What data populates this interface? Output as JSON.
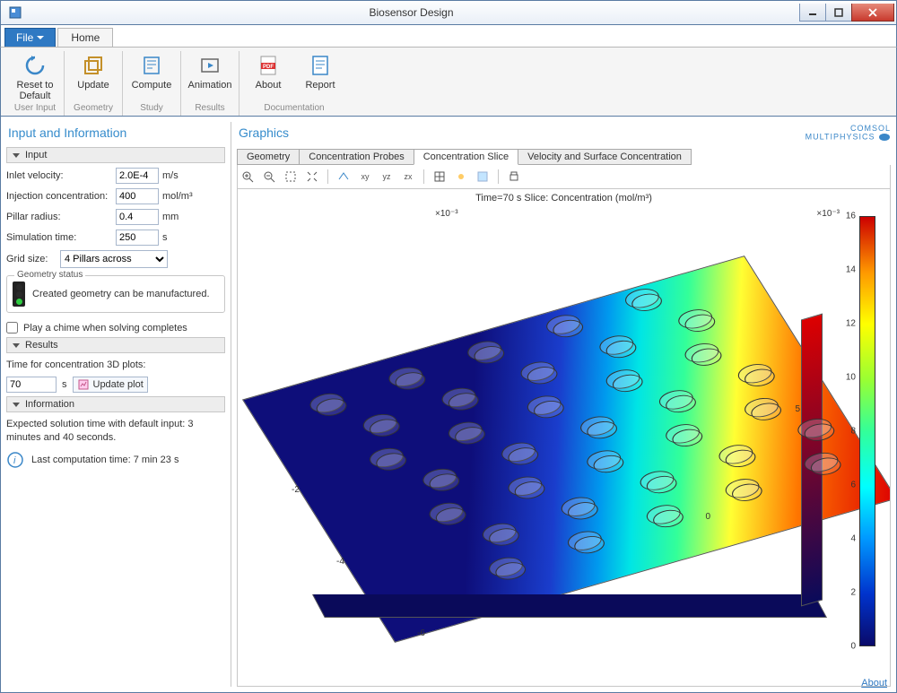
{
  "window": {
    "title": "Biosensor Design"
  },
  "ribbon": {
    "file_label": "File",
    "tabs": {
      "home": "Home"
    },
    "groups": [
      {
        "label": "User Input",
        "items": [
          {
            "name": "reset-to-default",
            "label": "Reset to\nDefault"
          }
        ]
      },
      {
        "label": "Geometry",
        "items": [
          {
            "name": "update-geometry",
            "label": "Update"
          }
        ]
      },
      {
        "label": "Study",
        "items": [
          {
            "name": "compute",
            "label": "Compute"
          }
        ]
      },
      {
        "label": "Results",
        "items": [
          {
            "name": "animation",
            "label": "Animation"
          }
        ]
      },
      {
        "label": "Documentation",
        "items": [
          {
            "name": "about",
            "label": "About"
          },
          {
            "name": "report",
            "label": "Report"
          }
        ]
      }
    ]
  },
  "left": {
    "title": "Input and Information",
    "sections": {
      "input": "Input",
      "results": "Results",
      "info": "Information"
    },
    "fields": {
      "inlet_velocity": {
        "label": "Inlet velocity:",
        "value": "2.0E-4",
        "unit": "m/s"
      },
      "injection_conc": {
        "label": "Injection concentration:",
        "value": "400",
        "unit": "mol/m³"
      },
      "pillar_radius": {
        "label": "Pillar radius:",
        "value": "0.4",
        "unit": "mm"
      },
      "sim_time": {
        "label": "Simulation time:",
        "value": "250",
        "unit": "s"
      },
      "grid_size": {
        "label": "Grid size:",
        "value": "4 Pillars across"
      }
    },
    "geom_status": {
      "legend": "Geometry status",
      "text": "Created geometry can be manufactured."
    },
    "chime": {
      "label": "Play a chime when solving completes",
      "checked": false
    },
    "results": {
      "label": "Time for concentration 3D plots:",
      "value": "70",
      "unit": "s",
      "button": "Update plot"
    },
    "info": {
      "expected": "Expected solution time with default input: 3 minutes and 40 seconds.",
      "last": "Last computation time: 7 min 23 s"
    }
  },
  "graphics": {
    "title": "Graphics",
    "brand": {
      "top": "COMSOL",
      "bottom": "MULTIPHYSICS"
    },
    "tabs": [
      "Geometry",
      "Concentration Probes",
      "Concentration Slice",
      "Velocity and Surface Concentration"
    ],
    "active_tab": 2,
    "plot_title": "Time=70 s   Slice: Concentration (mol/m³)",
    "axis_exp_left": "×10⁻³",
    "axis_exp_right": "×10⁻³",
    "colorbar_ticks": [
      16,
      14,
      12,
      10,
      8,
      6,
      4,
      2,
      0
    ],
    "axis_ticks": {
      "front": [
        5,
        0
      ],
      "side": [
        -2,
        -4,
        -6
      ]
    },
    "about_link": "About"
  },
  "chart_data": {
    "type": "heatmap",
    "title": "Time=70 s   Slice: Concentration (mol/m³)",
    "colorbar_label": "Concentration (mol/m³)",
    "colorbar_range": [
      0,
      16
    ],
    "colorbar_ticks": [
      0,
      2,
      4,
      6,
      8,
      10,
      12,
      14,
      16
    ],
    "x_exponent": "×10⁻³",
    "y_exponent": "×10⁻³",
    "x_ticks": [
      0,
      5
    ],
    "y_ticks": [
      -6,
      -4,
      -2
    ],
    "pillar_grid": {
      "columns": 4,
      "rows_approx": 8,
      "radius_mm": 0.4
    }
  }
}
